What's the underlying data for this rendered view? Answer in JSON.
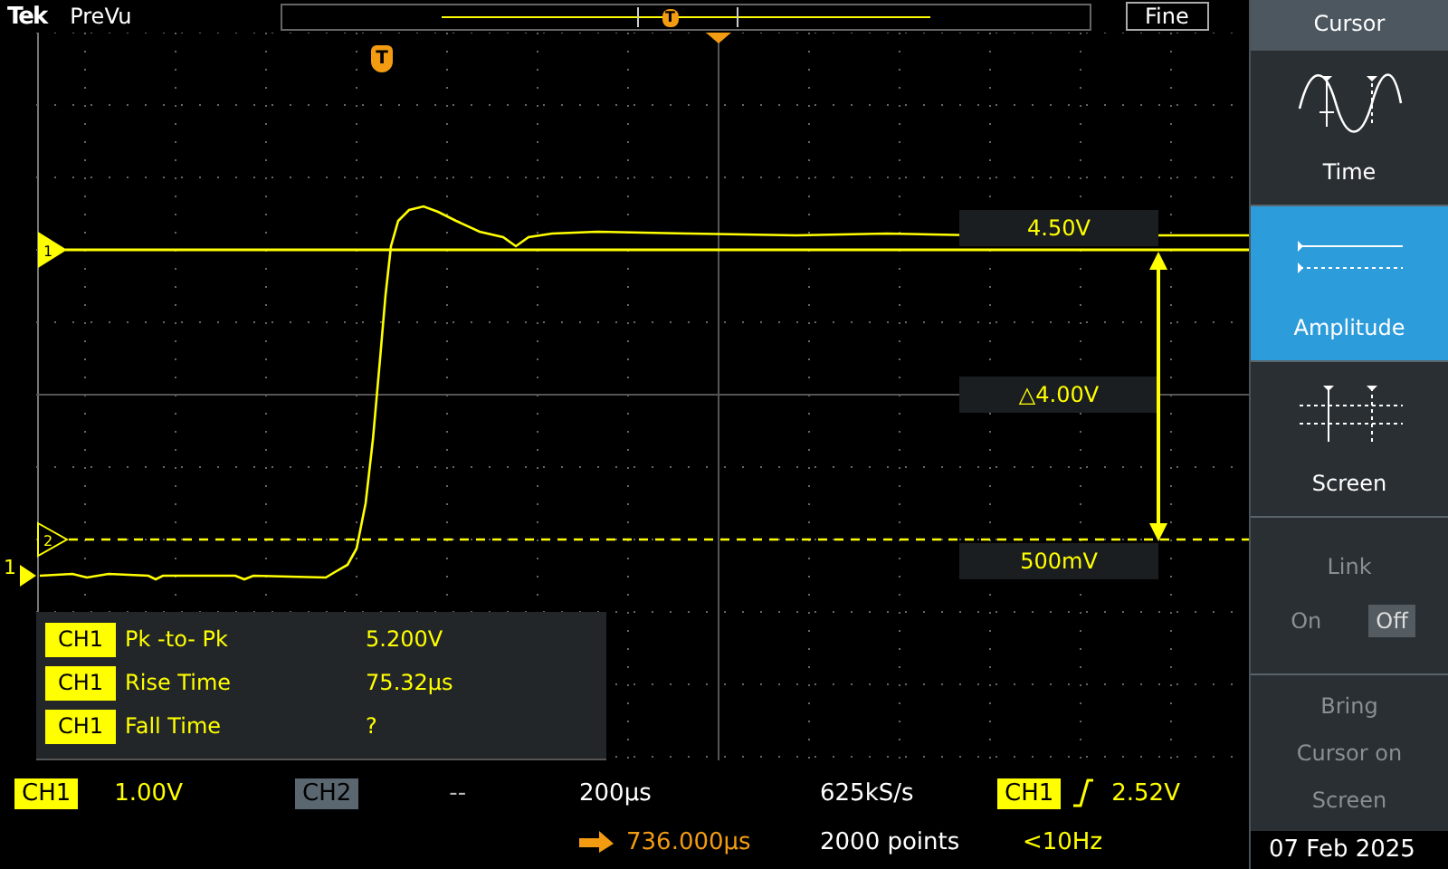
{
  "header": {
    "logo": "Tek",
    "mode": "PreVu",
    "overview_trigger": "T",
    "fine_button": "Fine"
  },
  "plot": {
    "trigger_marker": "T",
    "channel_marker": "1",
    "cursor_markers": [
      {
        "label": "1",
        "kind": "solid"
      },
      {
        "label": "2",
        "kind": "dashed"
      }
    ],
    "cursor_readouts": [
      {
        "kind": "upper",
        "text": "4.50V"
      },
      {
        "kind": "delta",
        "text": "△4.00V"
      },
      {
        "kind": "lower",
        "text": "500mV"
      }
    ]
  },
  "measurements": [
    {
      "channel": "CH1",
      "name": "Pk -to- Pk",
      "value": "5.200V"
    },
    {
      "channel": "CH1",
      "name": "Rise Time",
      "value": "75.32µs"
    },
    {
      "channel": "CH1",
      "name": "Fall Time",
      "value": "?"
    }
  ],
  "status": {
    "ch1": {
      "label": "CH1",
      "scale": "1.00V",
      "on": true
    },
    "ch2": {
      "label": "CH2",
      "scale": "--",
      "on": false
    },
    "horizontal": {
      "scale": "200µs",
      "position": "736.000µs"
    },
    "acquisition": {
      "rate": "625kS/s",
      "record": "2000 points"
    },
    "trigger": {
      "source": "CH1",
      "level": "2.52V",
      "frequency": "<10Hz"
    }
  },
  "side_panel": {
    "title": "Cursor",
    "modes": [
      {
        "label": "Time",
        "kind": "time",
        "selected": false
      },
      {
        "label": "Amplitude",
        "kind": "amplitude",
        "selected": true
      },
      {
        "label": "Screen",
        "kind": "screen",
        "selected": false
      }
    ],
    "link": {
      "label": "Link",
      "disabled": true,
      "options": [
        {
          "label": "On",
          "selected": false
        },
        {
          "label": "Off",
          "selected": true
        }
      ]
    },
    "bring_button": "Bring Cursor on Screen"
  },
  "date": "07 Feb 2025"
}
